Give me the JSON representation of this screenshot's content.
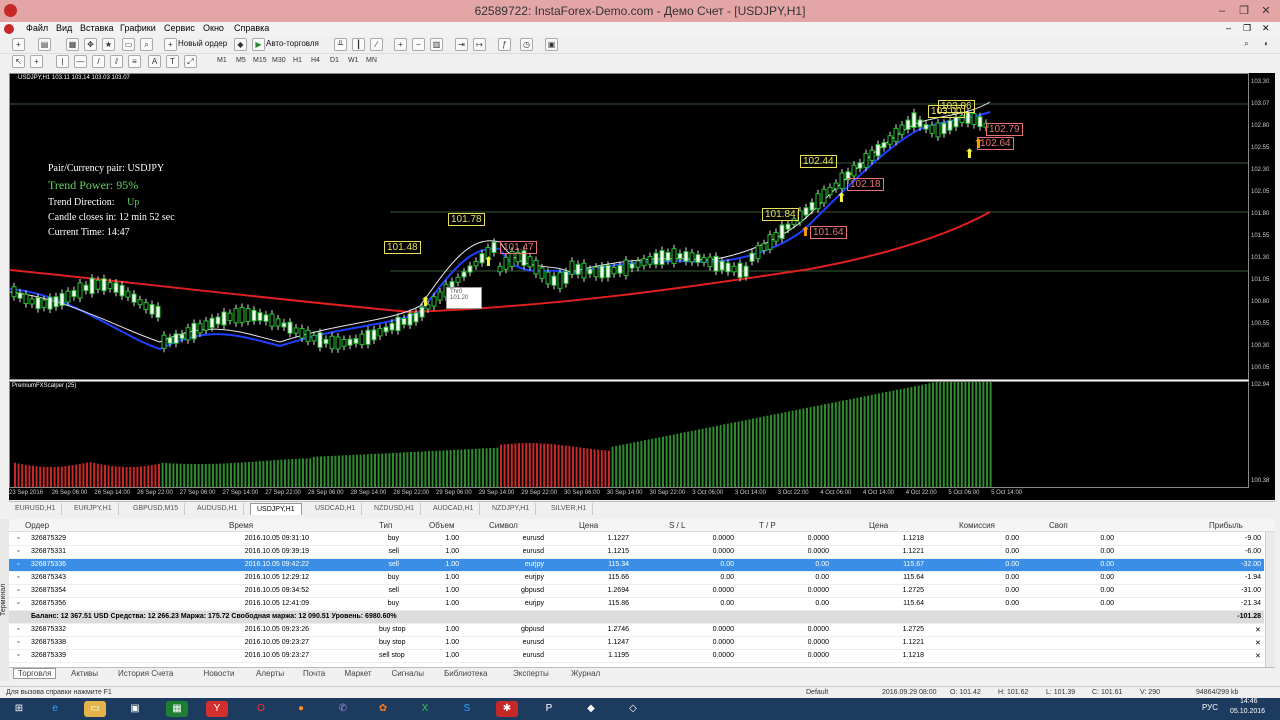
{
  "window": {
    "title": "62589722: InstaForex-Demo.com - Демо Счет - [USDJPY,H1]"
  },
  "menu": [
    "Файл",
    "Вид",
    "Вставка",
    "Графики",
    "Сервис",
    "Окно",
    "Справка"
  ],
  "toolbar": {
    "new_order": "Новый ордер",
    "autotrading": "Авто-торговля"
  },
  "timeframes": [
    "M1",
    "M5",
    "M15",
    "M30",
    "H1",
    "H4",
    "D1",
    "W1",
    "MN"
  ],
  "chart": {
    "header": "USDJPY,H1  103.11 103.14 103.03 103.07",
    "info": {
      "pair": "Pair/Currency pair: USDJPY",
      "power": "Trend Power: 95%",
      "direction_label": "Trend Direction:",
      "direction": "Up",
      "candle": "Candle closes in: 12 min 52 sec",
      "time": "Current Time: 14:47"
    },
    "levels": [
      "101.48",
      "101.78",
      "101.47",
      "101.84",
      "102.44",
      "101.64",
      "102.18",
      "103.06",
      "103.00",
      "102.79",
      "102.64",
      "101.20"
    ],
    "hover_label": "Thr0",
    "indicator_label": "PremiumFXScalper (25)",
    "price_axis": [
      "103.30",
      "103.07",
      "102.80",
      "102.55",
      "102.30",
      "102.05",
      "101.80",
      "101.55",
      "101.30",
      "101.05",
      "100.80",
      "100.55",
      "100.30",
      "100.05"
    ],
    "ind_axis": [
      "102.94",
      "100.38"
    ],
    "time_axis": [
      "23 Sep 2016",
      "26 Sep 06:00",
      "26 Sep 14:00",
      "26 Sep 22:00",
      "27 Sep 06:00",
      "27 Sep 14:00",
      "27 Sep 22:00",
      "28 Sep 06:00",
      "28 Sep 14:00",
      "28 Sep 22:00",
      "29 Sep 06:00",
      "29 Sep 14:00",
      "29 Sep 22:00",
      "30 Sep 06:00",
      "30 Sep 14:00",
      "30 Sep 22:00",
      "3 Oct 06:00",
      "3 Oct 14:00",
      "3 Oct 22:00",
      "4 Oct 06:00",
      "4 Oct 14:00",
      "4 Oct 22:00",
      "5 Oct 06:00",
      "5 Oct 14:00"
    ]
  },
  "chart_tabs": [
    "EURUSD,H1",
    "EURJPY,H1",
    "GBPUSD,M15",
    "AUDUSD,H1",
    "USDJPY,H1",
    "USDCAD,H1",
    "NZDUSD,H1",
    "AUDCAD,H1",
    "NZDJPY,H1",
    "SILVER,H1"
  ],
  "active_chart_tab": "USDJPY,H1",
  "terminal": {
    "headers": [
      "Ордер",
      "Время",
      "Тип",
      "Объем",
      "Символ",
      "Цена",
      "S / L",
      "T / P",
      "Цена",
      "Комиссия",
      "Своп",
      "Прибыль"
    ],
    "orders": [
      [
        "326875329",
        "2016.10.05 09:31:10",
        "buy",
        "1.00",
        "eurusd",
        "1.1227",
        "0.0000",
        "0.0000",
        "1.1218",
        "0.00",
        "0.00",
        "-9.00"
      ],
      [
        "326875331",
        "2016.10.05 09:39:19",
        "sell",
        "1.00",
        "eurusd",
        "1.1215",
        "0.0000",
        "0.0000",
        "1.1221",
        "0.00",
        "0.00",
        "-6.00"
      ],
      [
        "326875336",
        "2016.10.05 09:42:22",
        "sell",
        "1.00",
        "eurjpy",
        "115.34",
        "0.00",
        "0.00",
        "115.67",
        "0.00",
        "0.00",
        "-32.00"
      ],
      [
        "326875343",
        "2016.10.05 12:29:12",
        "buy",
        "1.00",
        "eurjpy",
        "115.66",
        "0.00",
        "0.00",
        "115.64",
        "0.00",
        "0.00",
        "-1.94"
      ],
      [
        "326875354",
        "2016.10.05 09:34:52",
        "sell",
        "1.00",
        "gbpusd",
        "1.2694",
        "0.0000",
        "0.0000",
        "1.2725",
        "0.00",
        "0.00",
        "-31.00"
      ],
      [
        "326875356",
        "2016.10.05 12:41:09",
        "buy",
        "1.00",
        "eurjpy",
        "115.86",
        "0.00",
        "0.00",
        "115.64",
        "0.00",
        "0.00",
        "-21.34"
      ]
    ],
    "balance": "Баланс: 12 367.51 USD  Средства: 12 266.23  Маржа: 175.72  Свободная маржа: 12 090.51  Уровень: 6980.60%",
    "balance_total": "-101.28",
    "pending": [
      [
        "326875332",
        "2016.10.05 09:23:26",
        "buy stop",
        "1.00",
        "gbpusd",
        "1.2746",
        "0.0000",
        "0.0000",
        "1.2725"
      ],
      [
        "326875338",
        "2016.10.05 09:23:27",
        "buy stop",
        "1.00",
        "eurusd",
        "1.1247",
        "0.0000",
        "0.0000",
        "1.1221"
      ],
      [
        "326875339",
        "2016.10.05 09:23:27",
        "sell stop",
        "1.00",
        "eurusd",
        "1.1195",
        "0.0000",
        "0.0000",
        "1.1218"
      ]
    ],
    "tabs": [
      "Торговля",
      "Активы",
      "История Счета",
      "Новости",
      "Алерты",
      "Почта",
      "Маркет",
      "Сигналы",
      "Библиотека",
      "Эксперты",
      "Журнал"
    ],
    "side_label": "Терминал"
  },
  "status": {
    "help": "Для вызова справки нажмите F1",
    "profile": "Default",
    "time": "2016.09.29 08:00",
    "o": "O: 101.42",
    "h": "H: 101.62",
    "l": "L: 101.39",
    "cl": "C: 101.61",
    "v": "V: 290",
    "traffic": "94864/299 kb"
  },
  "taskbar": {
    "lang": "РУС",
    "clock": "14:46",
    "date": "05.10.2016"
  }
}
